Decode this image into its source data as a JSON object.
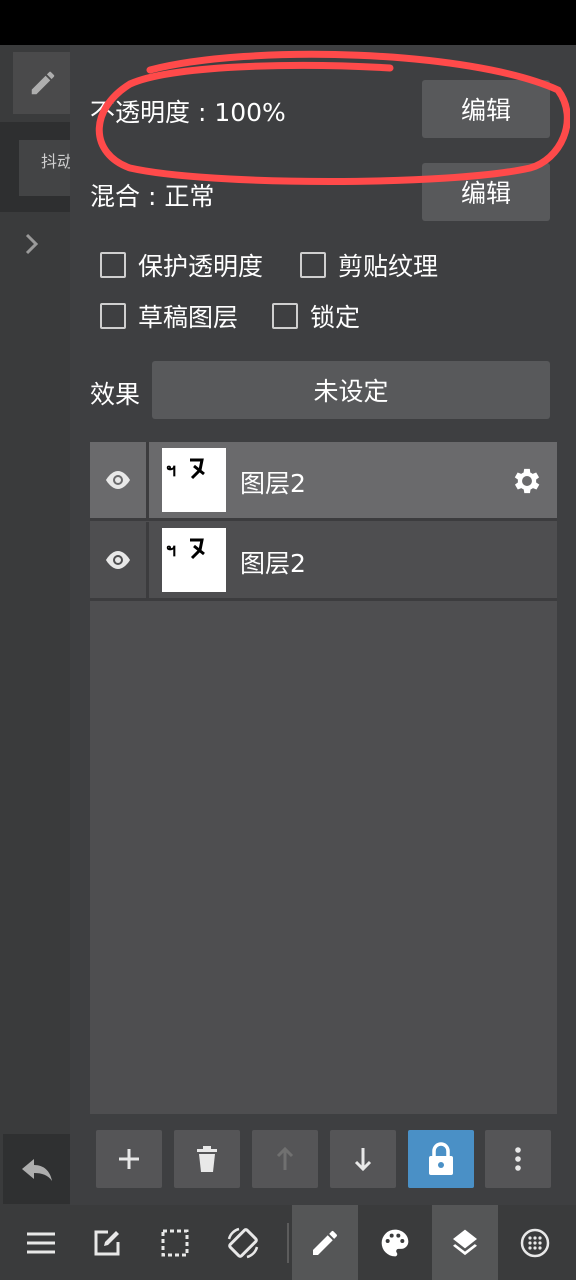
{
  "left": {
    "tab_text": "抖动"
  },
  "panel": {
    "opacity_label": "不透明度 : 100%",
    "opacity_edit": "编辑",
    "blend_label": "混合 : 正常",
    "blend_edit": "编辑",
    "checks": [
      {
        "label": "保护透明度"
      },
      {
        "label": "剪贴纹理"
      },
      {
        "label": "草稿图层"
      },
      {
        "label": "锁定"
      }
    ],
    "effect_label": "效果",
    "effect_value": "未设定"
  },
  "layers": [
    {
      "name": "图层2",
      "selected": true
    },
    {
      "name": "图层2",
      "selected": false
    }
  ],
  "colors": {
    "accent": "#4a90c6",
    "annotation": "#ff4a4a"
  },
  "icons": {
    "layer_tools": [
      "plus-icon",
      "trash-icon",
      "arrow-up-icon",
      "arrow-down-icon",
      "lock-icon",
      "more-vertical-icon"
    ],
    "bottom_bar": [
      "menu-icon",
      "edit-square-icon",
      "selection-icon",
      "rotate-screen-icon",
      "pencil-icon",
      "palette-icon",
      "layers-icon",
      "dots-grid-icon"
    ]
  }
}
